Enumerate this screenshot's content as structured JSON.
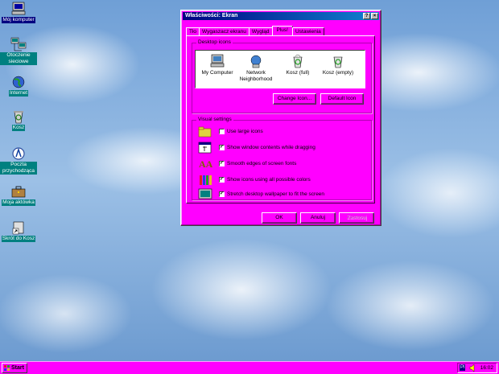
{
  "desktop": {
    "icons": [
      {
        "label": "Mój komputer",
        "icon": "my-computer-icon"
      },
      {
        "label": "Otoczenie sieciowe",
        "icon": "network-neighborhood-icon"
      },
      {
        "label": "Internet",
        "icon": "internet-icon"
      },
      {
        "label": "Kosz",
        "icon": "recycle-bin-icon"
      },
      {
        "label": "Poczta przychodząca",
        "icon": "inbox-icon"
      },
      {
        "label": "Moja aktówka",
        "icon": "briefcase-icon"
      },
      {
        "label": "Skrót do Kosz",
        "icon": "shortcut-recycle-icon"
      }
    ]
  },
  "dialog": {
    "title": "Właściwości: Ekran",
    "title_buttons": {
      "help": "?",
      "close": "×"
    },
    "tabs": [
      "Tło",
      "Wygaszacz ekranu",
      "Wygląd",
      "Plus!",
      "Ustawienia"
    ],
    "active_tab": "Plus!",
    "desktop_icons_group": {
      "legend": "Desktop icons",
      "icons": [
        {
          "label": "My Computer",
          "icon": "my-computer-icon"
        },
        {
          "label": "Network Neighborhood",
          "icon": "network-neighborhood-icon"
        },
        {
          "label": "Kosz (full)",
          "icon": "recycle-full-icon"
        },
        {
          "label": "Kosz (empty)",
          "icon": "recycle-empty-icon"
        }
      ],
      "change_icon_button": "Change Icon...",
      "default_icon_button": "Default Icon"
    },
    "visual_settings_group": {
      "legend": "Visual settings",
      "options": [
        {
          "label": "Use large icons",
          "checked": false,
          "icon": "folder-icon"
        },
        {
          "label": "Show window contents while dragging",
          "checked": true,
          "icon": "window-drag-icon"
        },
        {
          "label": "Smooth edges of screen fonts",
          "checked": true,
          "icon": "font-smooth-icon"
        },
        {
          "label": "Show icons using all possible colors",
          "checked": true,
          "icon": "colors-icon"
        },
        {
          "label": "Stretch desktop wallpaper to fit the screen",
          "checked": true,
          "icon": "wallpaper-icon"
        }
      ]
    },
    "buttons": {
      "ok": "OK",
      "cancel": "Anuluj",
      "apply": "Zastosuj"
    }
  },
  "taskbar": {
    "start_label": "Start",
    "tray_lang": "Pl",
    "clock": "16:02"
  },
  "colors": {
    "accent": "#ff00ff",
    "title_bar": "#000080",
    "desktop": "#7fa8d8"
  }
}
